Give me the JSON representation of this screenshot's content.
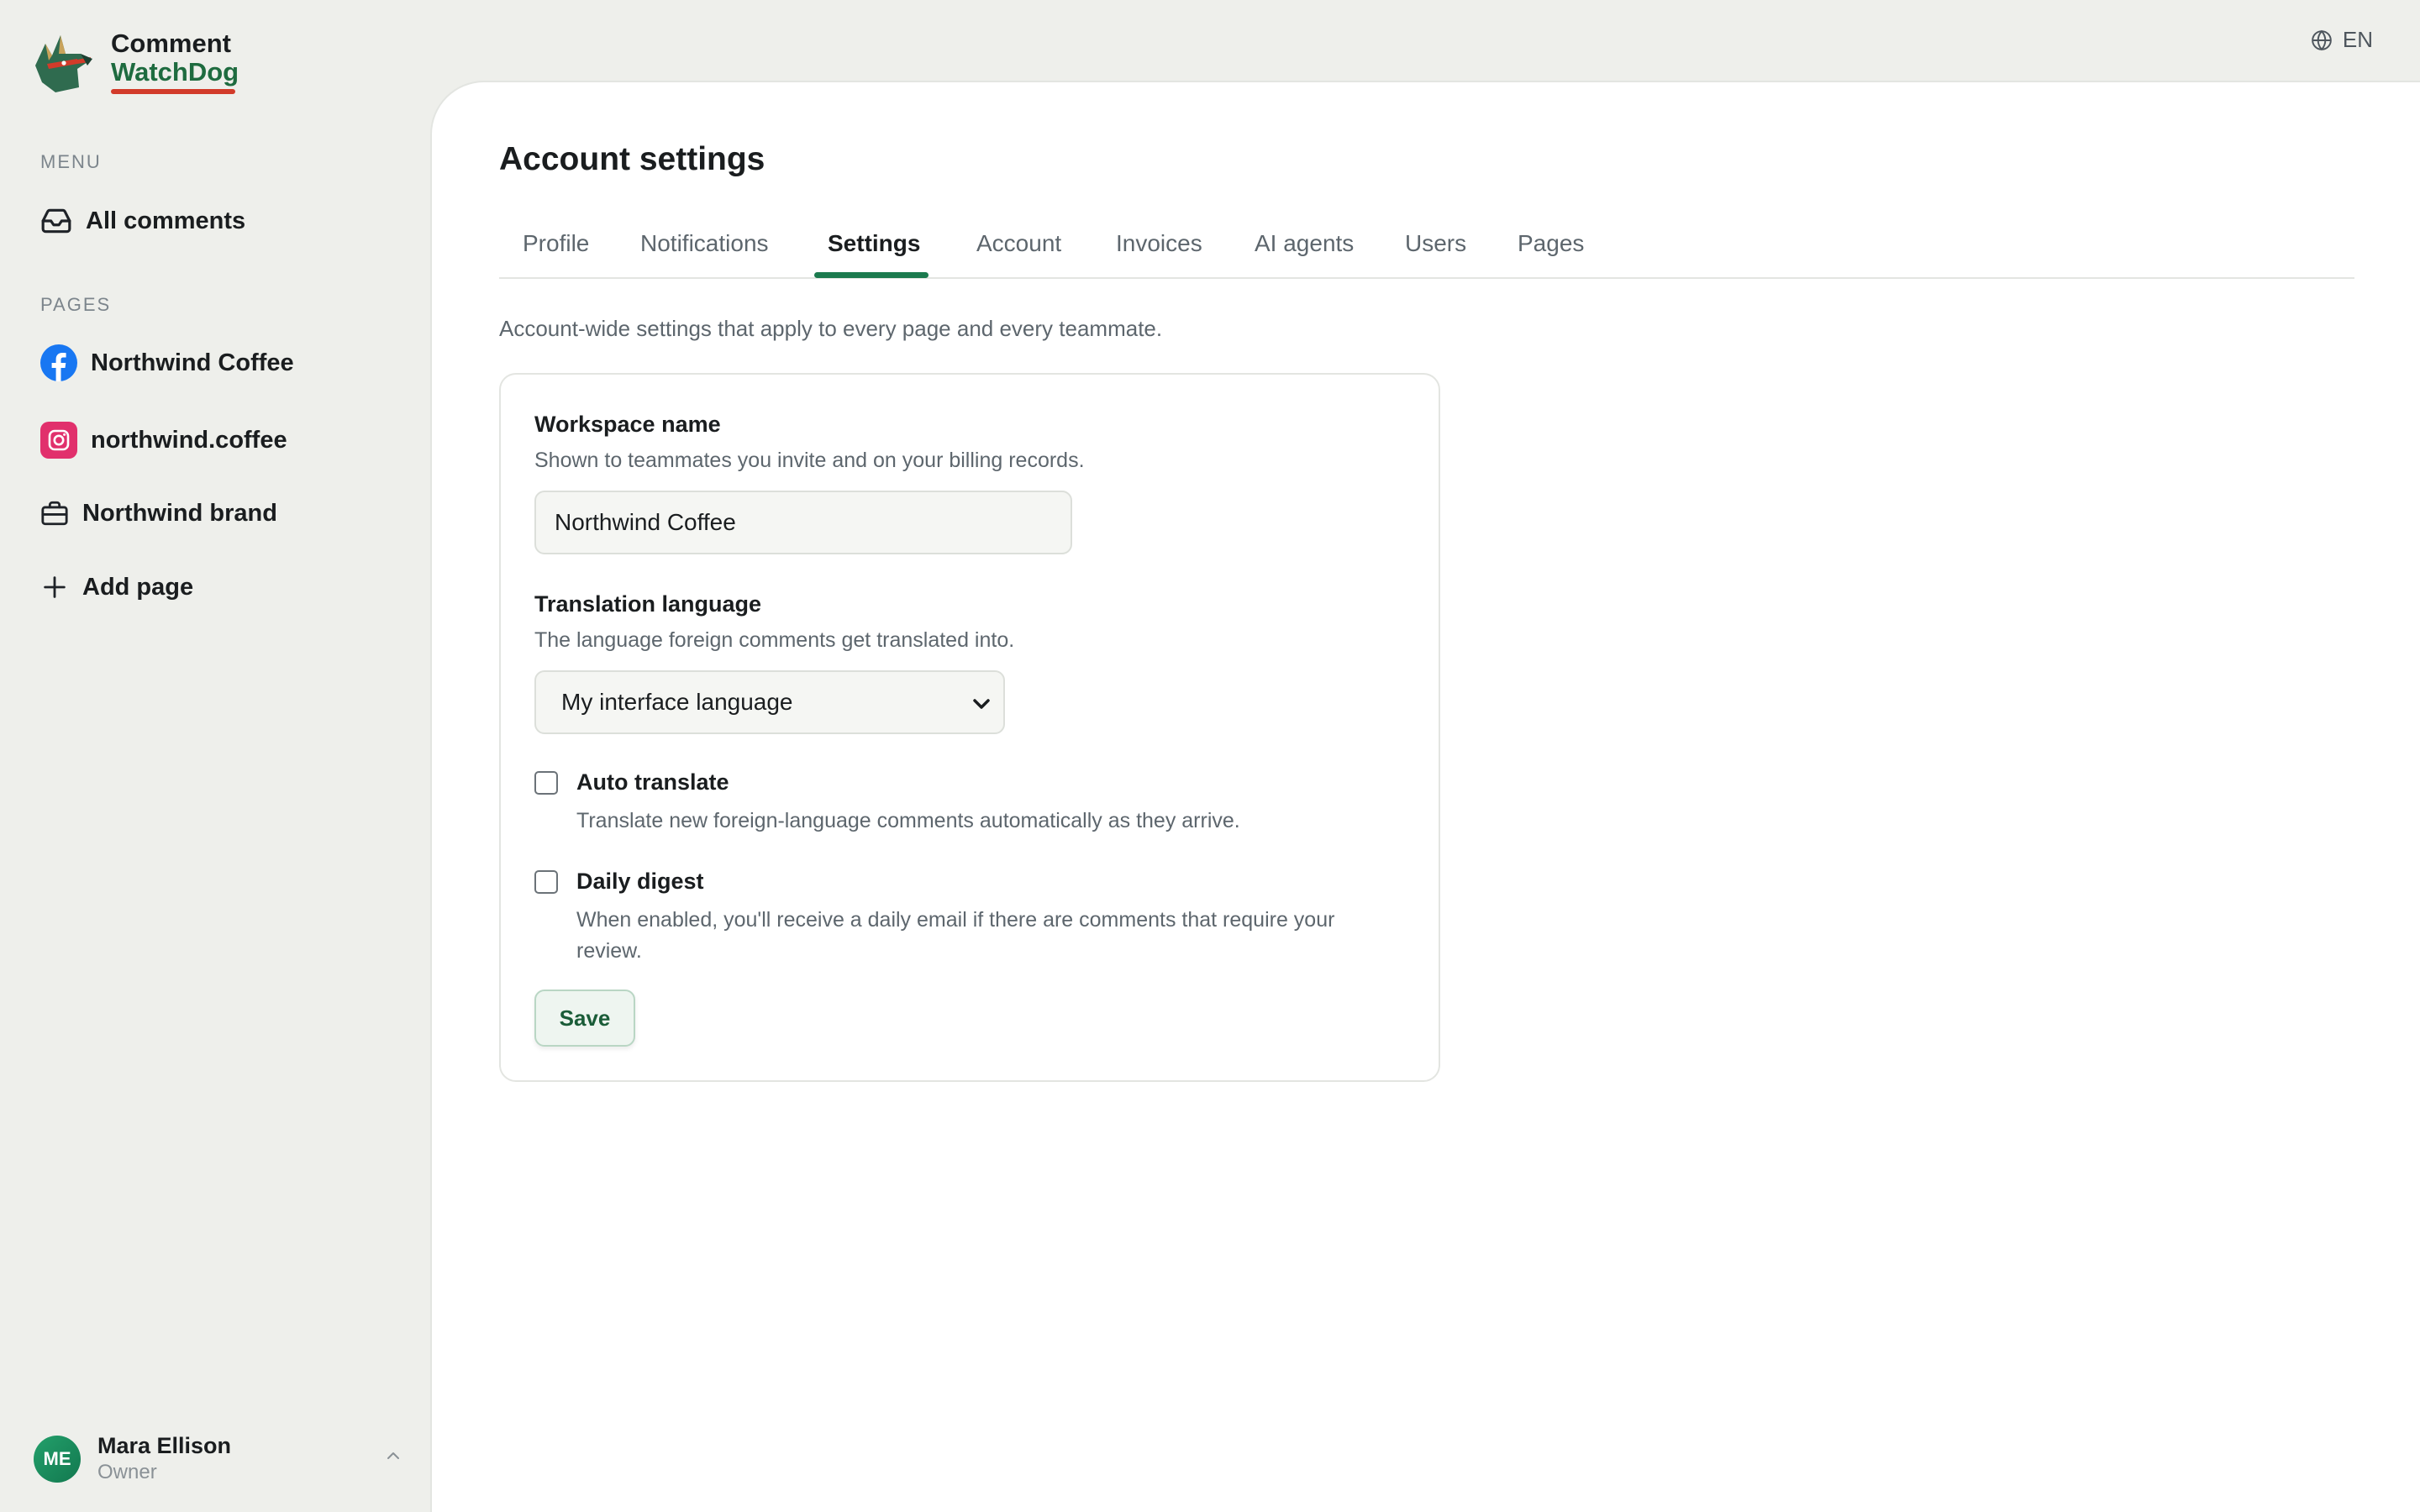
{
  "brand": {
    "line1": "Comment",
    "line2": "WatchDog"
  },
  "sidebar": {
    "menu_label": "MENU",
    "menu_items": [
      {
        "label": "All comments",
        "icon": "inbox-icon"
      }
    ],
    "pages_label": "PAGES",
    "pages": [
      {
        "label": "Northwind Coffee",
        "icon": "facebook-icon"
      },
      {
        "label": "northwind.coffee",
        "icon": "instagram-icon"
      },
      {
        "label": "Northwind brand",
        "icon": "briefcase-icon"
      }
    ],
    "add_page": {
      "label": "Add page",
      "icon": "plus-icon"
    }
  },
  "user": {
    "initials": "ME",
    "name": "Mara Ellison",
    "role": "Owner"
  },
  "language": {
    "label": "EN",
    "icon": "globe-icon"
  },
  "page": {
    "title": "Account settings",
    "tabs": [
      {
        "label": "Profile"
      },
      {
        "label": "Notifications"
      },
      {
        "label": "Settings",
        "active": true
      },
      {
        "label": "Account"
      },
      {
        "label": "Invoices"
      },
      {
        "label": "AI agents"
      },
      {
        "label": "Users"
      },
      {
        "label": "Pages"
      }
    ],
    "intro": "Account-wide settings that apply to every page and every teammate."
  },
  "settings": {
    "workspace": {
      "title": "Workspace name",
      "description": "Shown to teammates you invite and on your billing records.",
      "value": "Northwind Coffee"
    },
    "translation": {
      "title": "Translation language",
      "description": "The language foreign comments get translated into.",
      "selected": "My interface language"
    },
    "auto_translate": {
      "title": "Auto translate",
      "description": "Translate new foreign-language comments automatically as they arrive.",
      "checked": false
    },
    "daily_digest": {
      "title": "Daily digest",
      "description": "When enabled, you'll receive a daily email if there are comments that require your review.",
      "checked": false
    },
    "save_label": "Save"
  },
  "colors": {
    "accent": "#1b7a4e",
    "brand_green": "#1e6b3f",
    "brand_red": "#d23b2a",
    "facebook": "#1877f2",
    "instagram": "#e1306c"
  }
}
